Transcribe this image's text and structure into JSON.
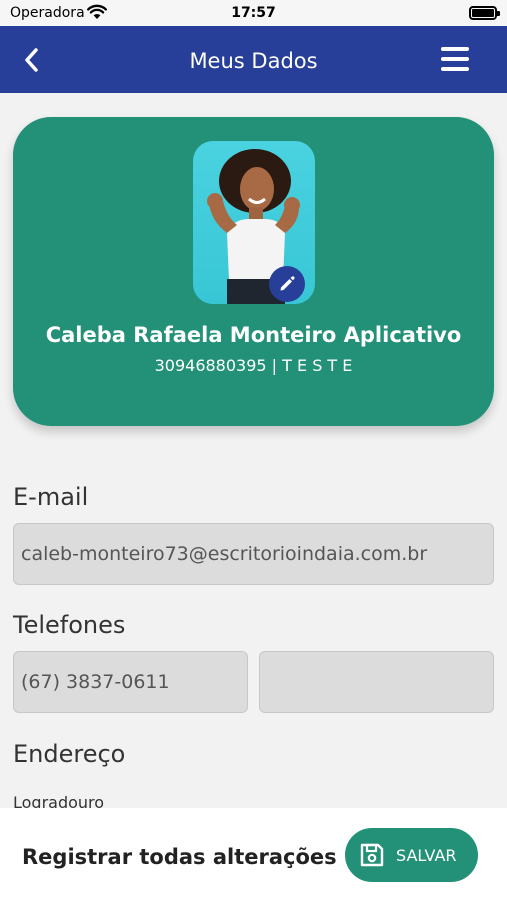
{
  "status_bar": {
    "carrier": "Operadora",
    "time": "17:57"
  },
  "header": {
    "title": "Meus Dados",
    "back_icon": "chevron-left-icon",
    "menu_icon": "hamburger-menu-icon"
  },
  "profile": {
    "name": "Caleba Rafaela Monteiro Aplicativo",
    "subtitle": "30946880395 | T E S T E",
    "edit_icon": "pencil-icon"
  },
  "email": {
    "label": "E-mail",
    "value": "caleb-monteiro73@escritorioindaia.com.br"
  },
  "phones": {
    "label": "Telefones",
    "values": [
      "(67) 3837-0611",
      ""
    ]
  },
  "address": {
    "label": "Endereço",
    "street_label": "Logradouro"
  },
  "footer": {
    "text": "Registrar todas alterações",
    "save_label": "SALVAR",
    "save_icon": "floppy-disk-icon"
  },
  "colors": {
    "header": "#273f98",
    "accent": "#239177",
    "background": "#f2f2f2",
    "field": "#dcdcdc"
  }
}
